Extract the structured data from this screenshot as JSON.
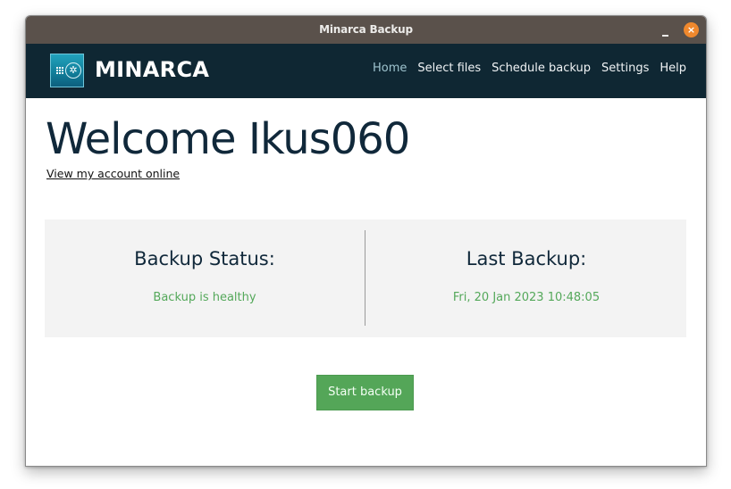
{
  "window": {
    "title": "Minarca Backup",
    "minimize_label": "minimize",
    "close_glyph": "×"
  },
  "navbar": {
    "brand": "MINARCA",
    "logo_icon": "minarca-logo-icon",
    "links": [
      {
        "label": "Home",
        "active": true
      },
      {
        "label": "Select files",
        "active": false
      },
      {
        "label": "Schedule backup",
        "active": false
      },
      {
        "label": "Settings",
        "active": false
      },
      {
        "label": "Help",
        "active": false
      }
    ]
  },
  "main": {
    "welcome": "Welcome Ikus060",
    "account_link": "View my account online",
    "status": {
      "backup_status_label": "Backup Status:",
      "backup_status_value": "Backup is healthy",
      "last_backup_label": "Last Backup:",
      "last_backup_value": "Fri, 20 Jan 2023 10:48:05"
    },
    "start_button": "Start backup"
  },
  "colors": {
    "titlebar": "#5a514b",
    "navbar": "#0f2733",
    "accent_green": "#54a658",
    "status_text_green": "#54a85a",
    "close_orange": "#f0882d",
    "active_nav": "#9fc4cf",
    "heading": "#10283a"
  }
}
